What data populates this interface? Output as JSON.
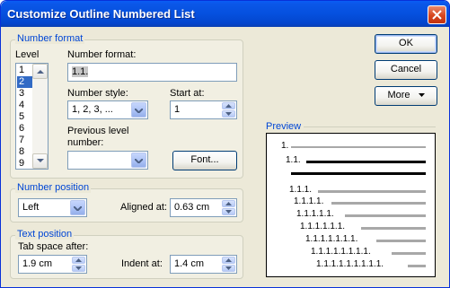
{
  "window": {
    "title": "Customize Outline Numbered List"
  },
  "number_format_group": {
    "title": "Number format",
    "level_label": "Level",
    "levels": [
      "1",
      "2",
      "3",
      "4",
      "5",
      "6",
      "7",
      "8",
      "9"
    ],
    "selected_level": "2",
    "number_format_label": "Number format:",
    "number_format_value": "1.1.",
    "number_style_label": "Number style:",
    "number_style_value": "1, 2, 3, ...",
    "start_at_label": "Start at:",
    "start_at_value": "1",
    "previous_level_label_line1": "Previous level",
    "previous_level_label_line2": "number:",
    "previous_level_value": "",
    "font_button": "Font..."
  },
  "number_position_group": {
    "title": "Number position",
    "alignment_value": "Left",
    "aligned_at_label": "Aligned at:",
    "aligned_at_value": "0.63 cm"
  },
  "text_position_group": {
    "title": "Text position",
    "tab_space_label": "Tab space after:",
    "tab_space_value": "1.9 cm",
    "indent_label": "Indent at:",
    "indent_value": "1.4 cm"
  },
  "buttons": {
    "ok": "OK",
    "cancel": "Cancel",
    "more": "More"
  },
  "preview": {
    "title": "Preview",
    "rows": [
      "1.",
      "1.1.",
      "",
      "1.1.1.",
      "1.1.1.1.",
      "1.1.1.1.1.",
      "1.1.1.1.1.1.",
      "1.1.1.1.1.1.1.",
      "1.1.1.1.1.1.1.1.",
      "1.1.1.1.1.1.1.1.1."
    ]
  },
  "colors": {
    "title_bar": "#0550de",
    "group_title": "#0046d5",
    "selection": "#316ac5",
    "close_button": "#d6461e"
  }
}
